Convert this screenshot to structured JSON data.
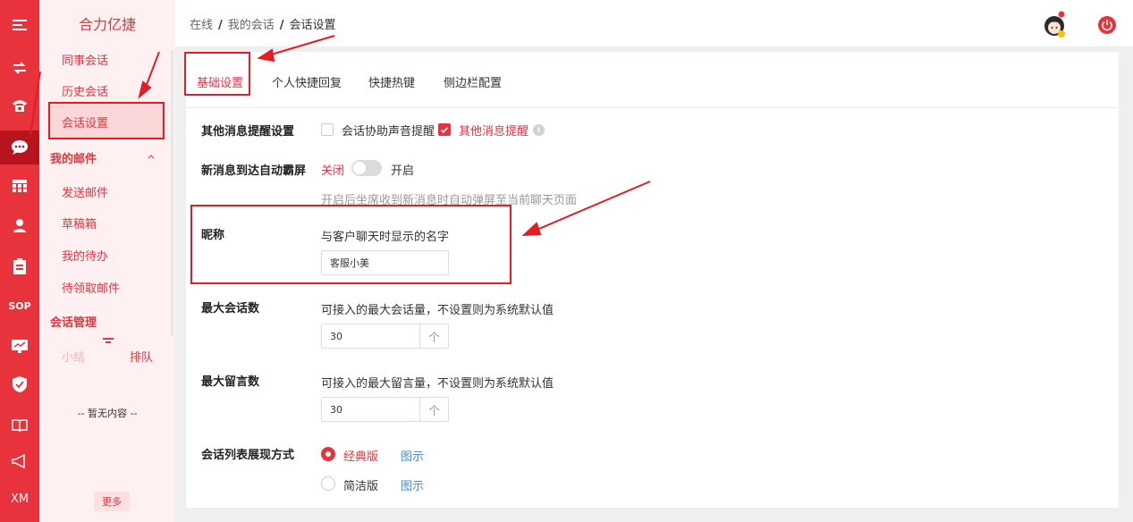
{
  "rail": {
    "items": [
      {
        "icon": "menu-icon"
      },
      {
        "icon": "transfer-icon"
      },
      {
        "icon": "telephone-icon"
      },
      {
        "icon": "chat-icon",
        "active": true
      },
      {
        "icon": "grid-icon"
      },
      {
        "icon": "user-icon"
      },
      {
        "icon": "clipboard-icon"
      },
      {
        "label": "SOP"
      },
      {
        "icon": "monitor-icon"
      },
      {
        "icon": "shield-icon"
      },
      {
        "icon": "book-icon"
      },
      {
        "icon": "megaphone-icon"
      },
      {
        "label": "XM"
      }
    ]
  },
  "sidebar": {
    "brand": "合力亿捷",
    "items_top": [
      "同事会话",
      "历史会话"
    ],
    "active_item": "会话设置",
    "mail_section": "我的邮件",
    "mail_items": [
      "发送邮件",
      "草稿箱",
      "我的待办",
      "待领取邮件"
    ],
    "manage_section": "会话管理",
    "mini_tabs": [
      "小结",
      "排队"
    ],
    "empty_text": "-- 暂无内容 --",
    "more_label": "更多"
  },
  "header": {
    "breadcrumb": [
      "在线",
      "我的会话",
      "会话设置"
    ],
    "separator": "/"
  },
  "tabs": [
    "基础设置",
    "个人快捷回复",
    "快捷热键",
    "侧边栏配置"
  ],
  "settings": {
    "notify": {
      "label": "其他消息提醒设置",
      "options": [
        {
          "label": "会话协助声音提醒",
          "checked": false
        },
        {
          "label": "其他消息提醒",
          "checked": true
        }
      ],
      "info": "i"
    },
    "popup": {
      "label": "新消息到达自动霸屏",
      "off": "关闭",
      "on": "开启",
      "enabled": false,
      "hint": "开启后坐席收到新消息时自动弹屏至当前聊天页面"
    },
    "nickname": {
      "label": "昵称",
      "desc": "与客户聊天时显示的名字",
      "value": "客服小美"
    },
    "max_sessions": {
      "label": "最大会话数",
      "desc": "可接入的最大会话量，不设置则为系统默认值",
      "value": "30",
      "unit": "个"
    },
    "max_messages": {
      "label": "最大留言数",
      "desc": "可接入的最大留言量，不设置则为系统默认值",
      "value": "30",
      "unit": "个"
    },
    "list_style": {
      "label": "会话列表展现方式",
      "options": [
        {
          "label": "经典版",
          "selected": true,
          "link": "图示"
        },
        {
          "label": "简洁版",
          "selected": false,
          "link": "图示"
        }
      ]
    }
  },
  "colors": {
    "brand": "#e8333d",
    "rail_active": "#b8141f",
    "sidebar_bg": "#fff1f1",
    "link": "#3a8ee6",
    "annotation": "#e51c23"
  }
}
